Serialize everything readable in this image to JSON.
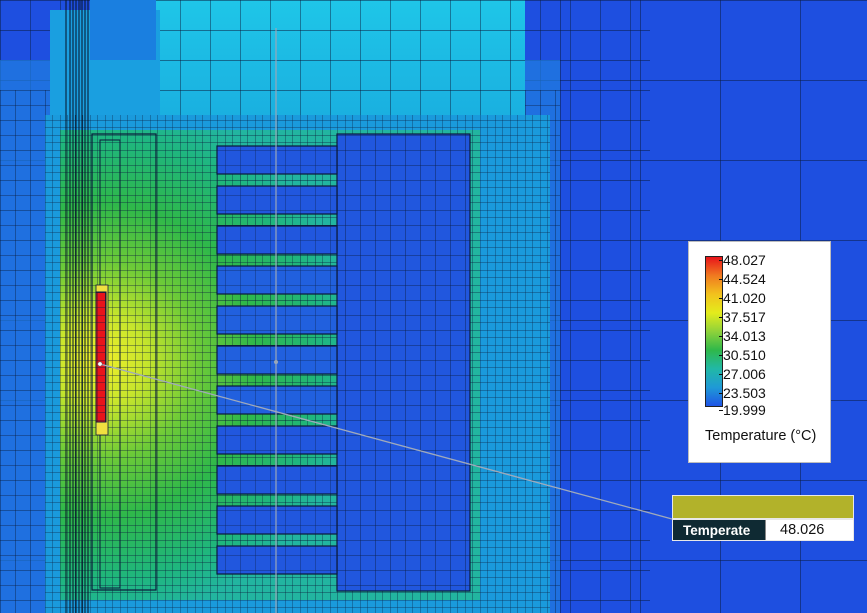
{
  "legend": {
    "title": "Temperature (°C)",
    "ticks": [
      "48.027",
      "44.524",
      "41.020",
      "37.517",
      "34.013",
      "30.510",
      "27.006",
      "23.503",
      "19.999"
    ],
    "gradient_colors": [
      "#e8141b",
      "#f07a20",
      "#f2c21d",
      "#e4ec1c",
      "#8fd23a",
      "#2fb84a",
      "#21b8a6",
      "#1f9ad6",
      "#1f55e6"
    ]
  },
  "probe": {
    "label": "Temperate",
    "value": "48.026",
    "swatch_color": "#b2b22a"
  },
  "colors": {
    "background": "#1e4fe0",
    "hot": "#e8141b",
    "warm": "#e4ec1c",
    "mid": "#2fb84a",
    "cool_cyan": "#18c1e0",
    "cold": "#1f55e6"
  }
}
